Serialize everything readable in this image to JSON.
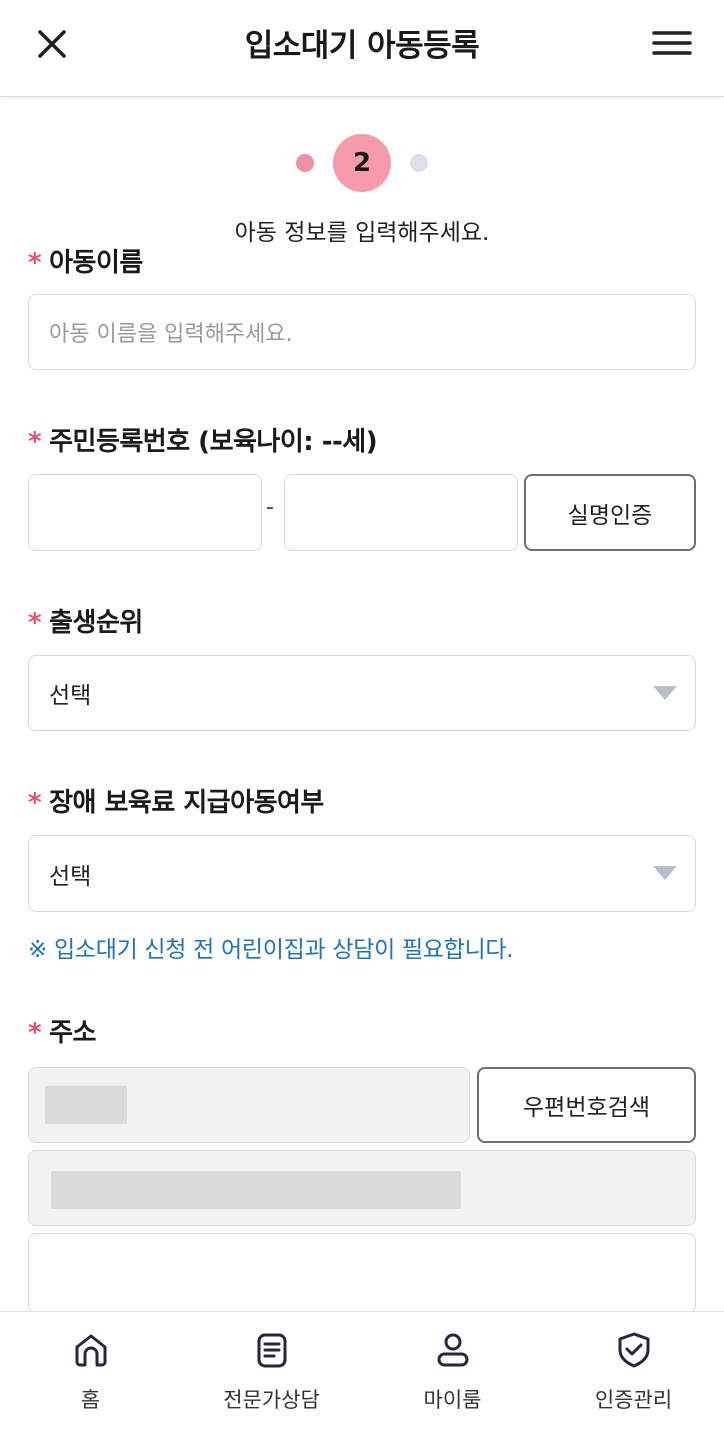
{
  "header": {
    "title": "입소대기 아동등록"
  },
  "stepper": {
    "current_step": "2",
    "description": "아동 정보를 입력해주세요."
  },
  "required_mark": "*",
  "child_name": {
    "label": "아동이름",
    "placeholder": "아동 이름을 입력해주세요."
  },
  "rrn": {
    "label": "주민등록번호 (보육나이: --세)",
    "separator": "-",
    "verify_button": "실명인증"
  },
  "birth_order": {
    "label": "출생순위",
    "value": "선택"
  },
  "disability": {
    "label": "장애 보육료 지급아동여부",
    "value": "선택"
  },
  "notice": "※ 입소대기 신청 전 어린이집과 상담이 필요합니다.",
  "address": {
    "label": "주소",
    "postcode_button": "우편번호검색"
  },
  "tabbar": {
    "home": "홈",
    "expert": "전문가상담",
    "myroom": "마이룸",
    "auth": "인증관리"
  },
  "colors": {
    "accent_pink": "#f49aa9",
    "required_red": "#e8516d",
    "notice_blue": "#1f73b7"
  }
}
